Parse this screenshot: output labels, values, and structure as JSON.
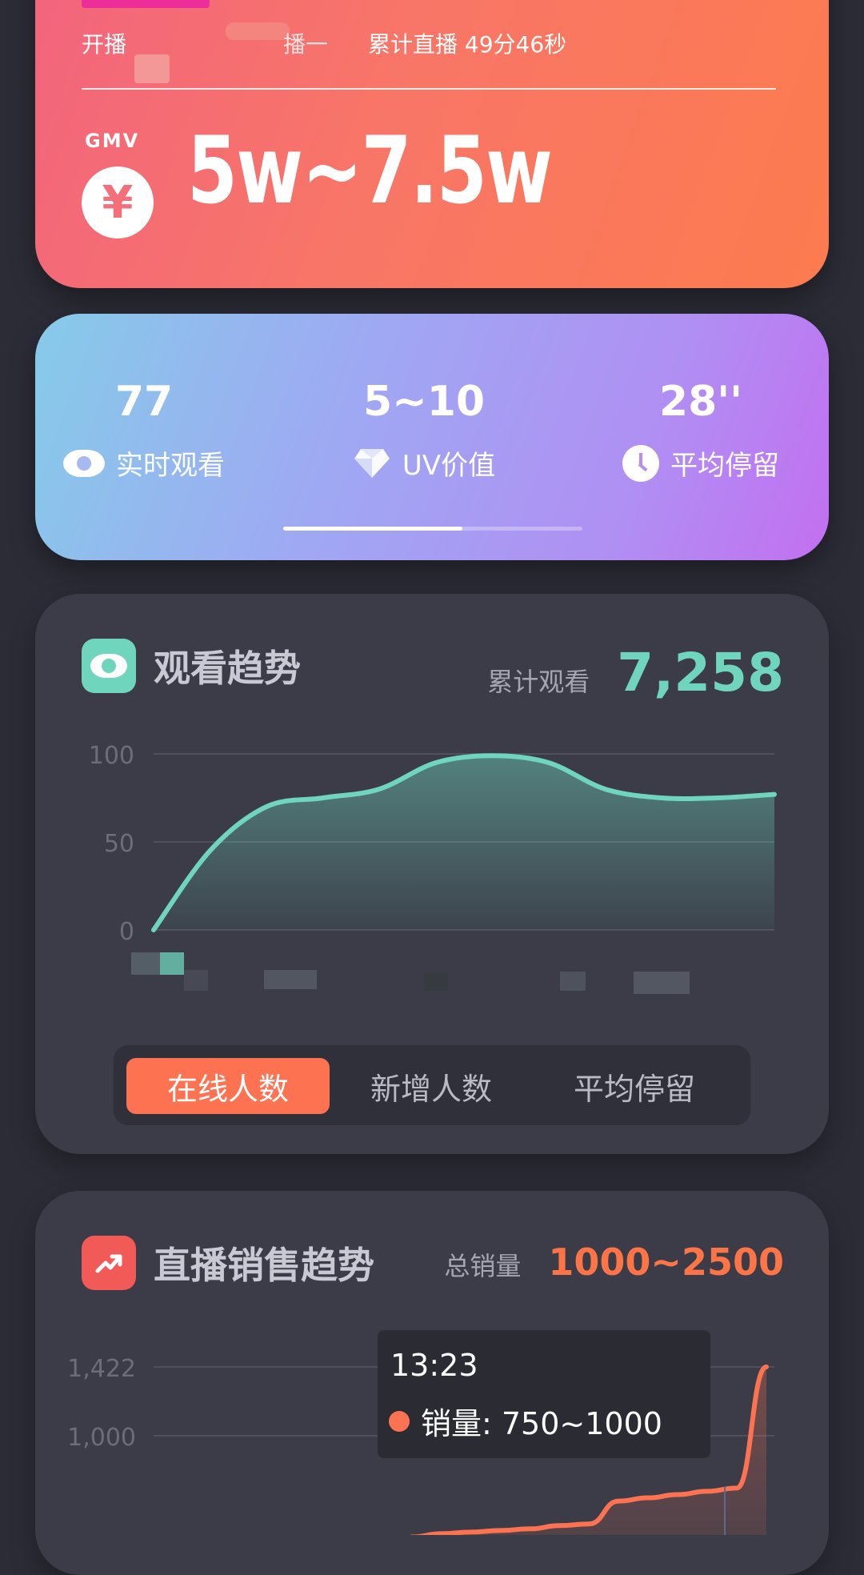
{
  "header": {
    "broadcast_prefix": "开播",
    "broadcast_sep": "播一",
    "total_live_time": "累计直播 49分46秒",
    "gmv_label": "GMV",
    "currency_symbol": "¥",
    "gmv_value": "5w~7.5w"
  },
  "stats": {
    "items": [
      {
        "value": "77",
        "label": "实时观看",
        "icon": "eye-icon"
      },
      {
        "value": "5~10",
        "label": "UV价值",
        "icon": "diamond-icon"
      },
      {
        "value": "28''",
        "label": "平均停留",
        "icon": "clock-icon"
      }
    ],
    "pager_progress": 0.6
  },
  "viewing_trend": {
    "title": "观看趋势",
    "metric_label": "累计观看",
    "metric_value": "7,258",
    "tabs": [
      {
        "label": "在线人数",
        "active": true
      },
      {
        "label": "新增人数",
        "active": false
      },
      {
        "label": "平均停留",
        "active": false
      }
    ],
    "accent_color": "#6fd6bd"
  },
  "sales_trend": {
    "title": "直播销售趋势",
    "metric_label": "总销量",
    "metric_value": "1000~2500",
    "tooltip_time": "13:23",
    "tooltip_text": "销量: 750~1000",
    "accent_color": "#fd7352"
  },
  "chart_data": [
    {
      "type": "area",
      "ylim": [
        0,
        100
      ],
      "yticks": [
        "100",
        "50",
        "0"
      ],
      "series": [
        {
          "values": [
            0,
            45,
            70,
            75,
            80,
            95,
            99,
            95,
            80,
            75,
            75,
            77
          ]
        }
      ]
    },
    {
      "type": "line",
      "yticks": [
        "1,422",
        "1,000"
      ],
      "ylim": [
        0,
        1422
      ],
      "series": [
        {
          "values": [
            0,
            380,
            400,
            410,
            420,
            430,
            450,
            460,
            600,
            620,
            640,
            660,
            680,
            1422
          ]
        }
      ]
    }
  ]
}
